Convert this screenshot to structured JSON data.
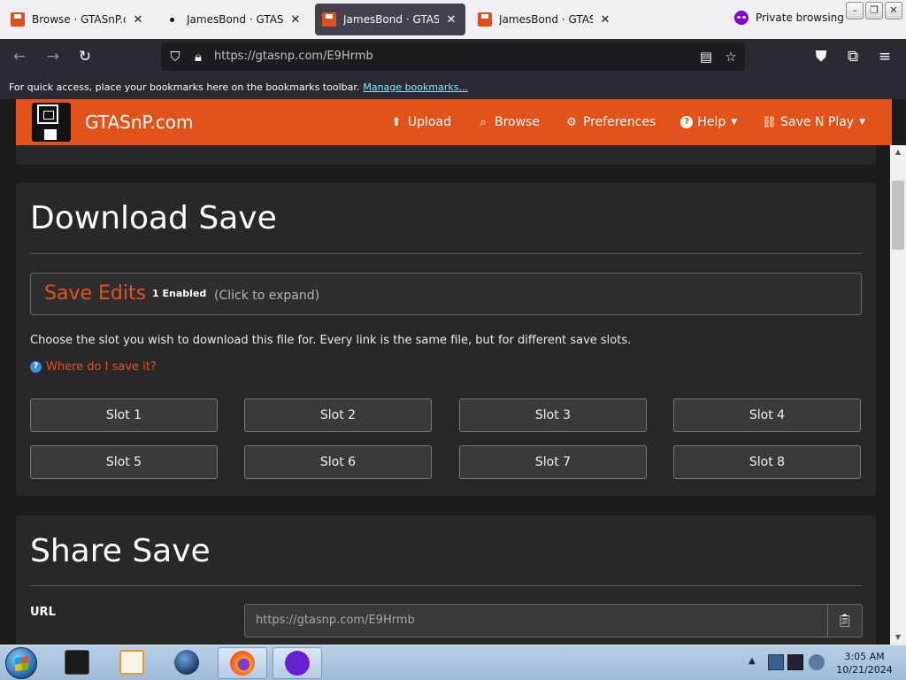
{
  "browser": {
    "tabs": [
      {
        "title": "Browse · GTASnP.com",
        "favicon": "save-favicon",
        "active": false
      },
      {
        "title": "JamesBond · GTASnP.c",
        "favicon": "dot",
        "active": false
      },
      {
        "title": "JamesBond · GTASnP.c",
        "favicon": "save-favicon",
        "active": true
      },
      {
        "title": "JamesBond · GTASnP.c",
        "favicon": "save-favicon",
        "active": false
      }
    ],
    "tab_close_glyph": "✕",
    "private_label": "Private browsing",
    "url": "https://gtasnp.com/E9Hrmb",
    "bookmarks_text": "For quick access, place your bookmarks here on the bookmarks toolbar.",
    "bookmarks_link": "Manage bookmarks..."
  },
  "site": {
    "brand": "GTASnP.com",
    "nav": [
      {
        "label": "Upload",
        "icon": "upload-icon",
        "glyph": "⬆",
        "caret": false
      },
      {
        "label": "Browse",
        "icon": "search-icon",
        "glyph": "⌕",
        "caret": false
      },
      {
        "label": "Preferences",
        "icon": "gear-icon",
        "glyph": "⚙",
        "caret": false
      },
      {
        "label": "Help",
        "icon": "question-icon",
        "glyph": "?",
        "caret": true
      },
      {
        "label": "Save N Play",
        "icon": "link-icon",
        "glyph": "🔗",
        "caret": true
      }
    ],
    "accent_color": "#e2531b"
  },
  "download": {
    "title": "Download Save",
    "edits_label": "Save Edits",
    "edits_badge": "1 Enabled",
    "edits_hint": "(Click to expand)",
    "description": "Choose the slot you wish to download this file for. Every link is the same file, but for different save slots.",
    "help_link": "Where do I save it?",
    "slots": [
      "Slot 1",
      "Slot 2",
      "Slot 3",
      "Slot 4",
      "Slot 5",
      "Slot 6",
      "Slot 7",
      "Slot 8"
    ]
  },
  "share": {
    "title": "Share Save",
    "url_label": "URL",
    "url_value": "https://gtasnp.com/E9Hrmb"
  },
  "taskbar": {
    "time": "3:05 AM",
    "date": "10/21/2024"
  }
}
